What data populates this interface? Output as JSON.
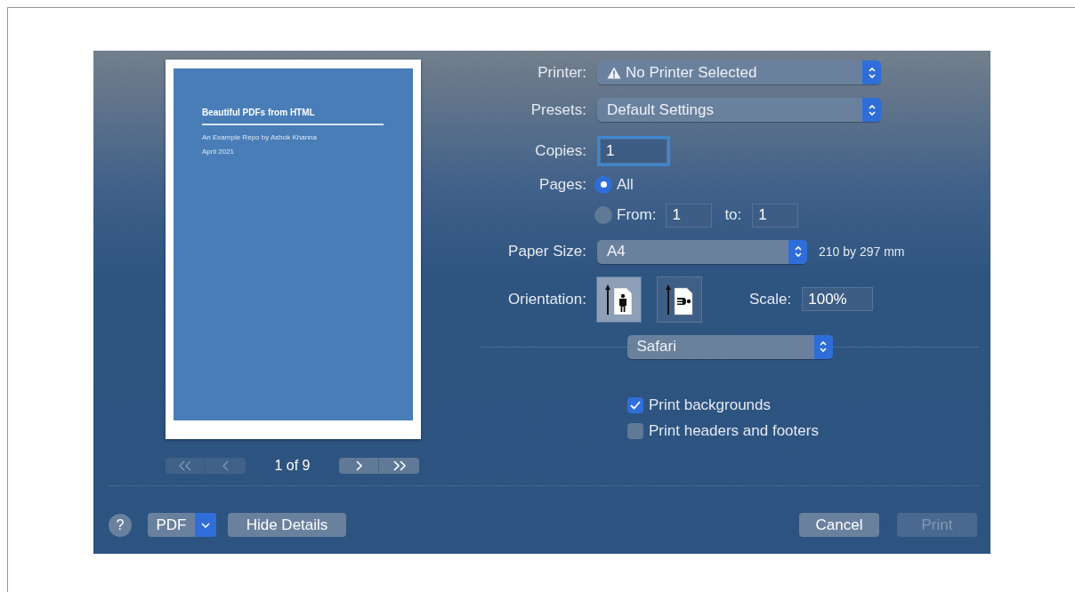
{
  "preview": {
    "title": "Beautiful PDFs from HTML",
    "subtitle": "An Example Repo by Ashok Khanna",
    "date": "April 2021",
    "page_label": "1 of 9",
    "nav": [
      {
        "kind": "first",
        "disabled": true
      },
      {
        "kind": "previous",
        "disabled": true
      },
      {
        "kind": "next",
        "disabled": false
      },
      {
        "kind": "last",
        "disabled": false
      }
    ]
  },
  "printer": {
    "label": "Printer:",
    "value": "No Printer Selected",
    "warning": true
  },
  "presets": {
    "label": "Presets:",
    "value": "Default Settings"
  },
  "copies": {
    "label": "Copies:",
    "value": "1",
    "focused": true
  },
  "pages": {
    "label": "Pages:",
    "options": [
      {
        "label": "All",
        "selected": true
      },
      {
        "label": "From:",
        "selected": false
      }
    ],
    "from": "1",
    "to_label": "to:",
    "to": "1"
  },
  "paper_size": {
    "label": "Paper Size:",
    "value": "A4",
    "dimensions": "210 by 297 mm"
  },
  "orientation": {
    "label": "Orientation:",
    "options": [
      {
        "kind": "portrait",
        "selected": true
      },
      {
        "kind": "landscape",
        "selected": false
      }
    ]
  },
  "scale": {
    "label": "Scale:",
    "value": "100%"
  },
  "app_menu": {
    "value": "Safari"
  },
  "options": [
    {
      "label": "Print backgrounds",
      "checked": true
    },
    {
      "label": "Print headers and footers",
      "checked": false
    }
  ],
  "footer": {
    "help": "?",
    "pdf": "PDF",
    "hide_details": "Hide Details",
    "cancel": "Cancel",
    "print": {
      "label": "Print",
      "disabled": true
    }
  }
}
